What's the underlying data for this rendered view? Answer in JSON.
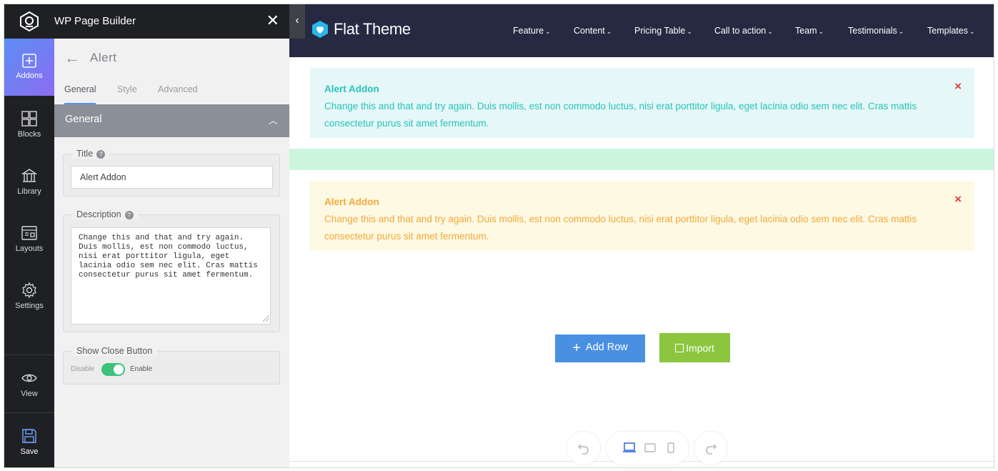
{
  "builder": {
    "title": "WP Page Builder",
    "close_glyph": "✕"
  },
  "rail": {
    "items": [
      {
        "label": "Addons",
        "icon": "plus-square-icon",
        "active": true
      },
      {
        "label": "Blocks",
        "icon": "blocks-grid-icon"
      },
      {
        "label": "Library",
        "icon": "library-building-icon"
      },
      {
        "label": "Layouts",
        "icon": "layouts-icon"
      },
      {
        "label": "Settings",
        "icon": "gear-icon"
      },
      {
        "label": "View",
        "icon": "eye-icon"
      },
      {
        "label": "Save",
        "icon": "floppy-disk-icon"
      }
    ]
  },
  "panel": {
    "back_glyph": "←",
    "title": "Alert",
    "tabs": [
      "General",
      "Style",
      "Advanced"
    ],
    "active_tab": "General",
    "section": "General",
    "section_chevron": "︿",
    "fields": {
      "title": {
        "label": "Title",
        "value": "Alert Addon"
      },
      "description": {
        "label": "Description",
        "value": "Change this and that and try again. Duis mollis, est non commodo luctus, nisi erat porttitor ligula, eget lacinia odio sem nec elit. Cras mattis consectetur purus sit amet fermentum."
      },
      "close_button": {
        "label": "Show Close Button",
        "off_label": "Disable",
        "on_label": "Enable",
        "enabled": true
      }
    },
    "help_glyph": "?"
  },
  "site": {
    "name": "Flat Theme",
    "collapse_glyph": "‹",
    "nav": [
      "Feature",
      "Content",
      "Pricing Table",
      "Call to action",
      "Team",
      "Testimonials",
      "Templates"
    ],
    "caret": "⌄",
    "alerts": [
      {
        "title": "Alert Addon",
        "text": "Change this and that and try again. Duis mollis, est non commodo luctus, nisi erat porttitor ligula, eget lacinia odio sem nec elit. Cras mattis consectetur purus sit amet fermentum.",
        "color": "#2ac2bb",
        "bg": "#e5f8f7"
      },
      {
        "title": "Alert Addon",
        "text": "Change this and that and try again. Duis mollis, est non commodo luctus, nisi erat porttitor ligula, eget lacinia odio sem nec elit. Cras mattis consectetur purus sit amet fermentum.",
        "color": "#f4a93a",
        "bg": "#fdf9e3"
      }
    ],
    "close_x": "×",
    "add_row": "Add Row",
    "add_plus": "+",
    "import": "Import"
  },
  "colors": {
    "header": "#252942",
    "rail": "#1f2023",
    "accent": "#5c8ef5",
    "toggle_on": "#3cc27a",
    "add_button": "#4a90e2",
    "import_button": "#8cc63f",
    "close_x": "#e0403a"
  }
}
